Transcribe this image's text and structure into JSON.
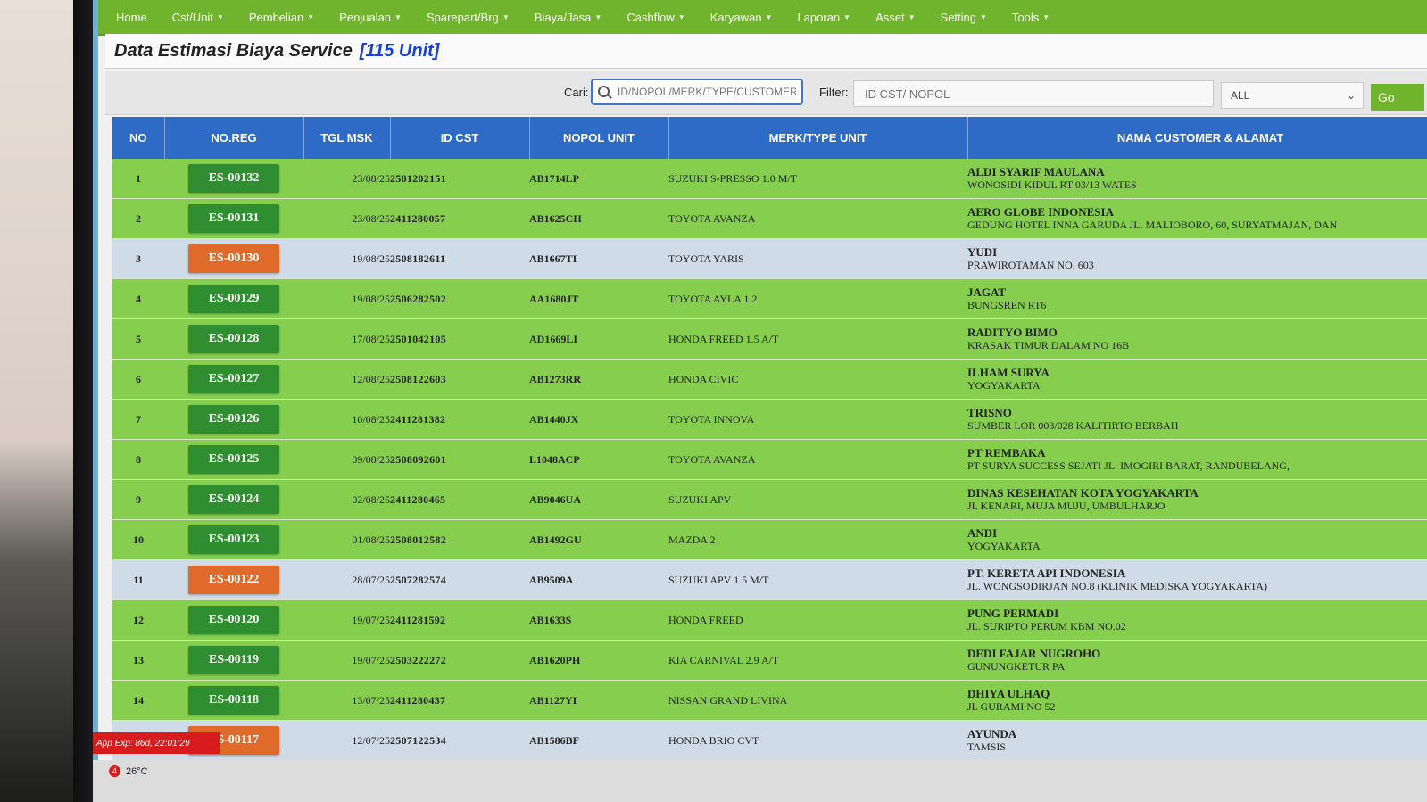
{
  "nav": {
    "items": [
      {
        "label": "Home",
        "caret": false
      },
      {
        "label": "Cst/Unit",
        "caret": true
      },
      {
        "label": "Pembelian",
        "caret": true
      },
      {
        "label": "Penjualan",
        "caret": true
      },
      {
        "label": "Sparepart/Brg",
        "caret": true
      },
      {
        "label": "Biaya/Jasa",
        "caret": true
      },
      {
        "label": "Cashflow",
        "caret": true
      },
      {
        "label": "Karyawan",
        "caret": true
      },
      {
        "label": "Laporan",
        "caret": true
      },
      {
        "label": "Asset",
        "caret": true
      },
      {
        "label": "Setting",
        "caret": true
      },
      {
        "label": "Tools",
        "caret": true
      }
    ]
  },
  "page": {
    "title": "Data Estimasi Biaya Service",
    "unit_count": "[115 Unit]"
  },
  "search": {
    "cari_label": "Cari:",
    "placeholder": "ID/NOPOL/MERK/TYPE/CUSTOMER",
    "filter_label": "Filter:",
    "filter_placeholder": "ID CST/ NOPOL",
    "select_value": "ALL",
    "go_label": "Go"
  },
  "table": {
    "headers": [
      "NO",
      "NO.REG",
      "TGL MSK",
      "ID CST",
      "NOPOL UNIT",
      "MERK/TYPE UNIT",
      "NAMA CUSTOMER & ALAMAT"
    ],
    "rows": [
      {
        "no": "1",
        "reg": "ES-00132",
        "status": "green",
        "tgl": "23/08/25",
        "idcst": "2501202151",
        "nopol": "AB1714LP",
        "merk": "SUZUKI S-PRESSO 1.0 M/T",
        "name": "ALDI SYARIF MAULANA",
        "addr": "WONOSIDI KIDUL RT 03/13 WATES"
      },
      {
        "no": "2",
        "reg": "ES-00131",
        "status": "green",
        "tgl": "23/08/25",
        "idcst": "2411280057",
        "nopol": "AB1625CH",
        "merk": "TOYOTA AVANZA",
        "name": "AERO GLOBE INDONESIA",
        "addr": "GEDUNG HOTEL INNA GARUDA JL. MALIOBORO, 60, SURYATMAJAN, DAN"
      },
      {
        "no": "3",
        "reg": "ES-00130",
        "status": "orange",
        "tgl": "19/08/25",
        "idcst": "2508182611",
        "nopol": "AB1667TI",
        "merk": "TOYOTA YARIS",
        "name": "YUDI",
        "addr": "PRAWIROTAMAN NO. 603"
      },
      {
        "no": "4",
        "reg": "ES-00129",
        "status": "green",
        "tgl": "19/08/25",
        "idcst": "2506282502",
        "nopol": "AA1680JT",
        "merk": "TOYOTA AYLA 1.2",
        "name": "JAGAT",
        "addr": "BUNGSREN RT6"
      },
      {
        "no": "5",
        "reg": "ES-00128",
        "status": "green",
        "tgl": "17/08/25",
        "idcst": "2501042105",
        "nopol": "AD1669LI",
        "merk": "HONDA FREED 1.5 A/T",
        "name": "RADITYO BIMO",
        "addr": "KRASAK TIMUR DALAM NO 16B"
      },
      {
        "no": "6",
        "reg": "ES-00127",
        "status": "green",
        "tgl": "12/08/25",
        "idcst": "2508122603",
        "nopol": "AB1273RR",
        "merk": "HONDA CIVIC",
        "name": "ILHAM SURYA",
        "addr": "YOGYAKARTA"
      },
      {
        "no": "7",
        "reg": "ES-00126",
        "status": "green",
        "tgl": "10/08/25",
        "idcst": "2411281382",
        "nopol": "AB1440JX",
        "merk": "TOYOTA INNOVA",
        "name": "TRISNO",
        "addr": "SUMBER LOR 003/028 KALITIRTO BERBAH"
      },
      {
        "no": "8",
        "reg": "ES-00125",
        "status": "green",
        "tgl": "09/08/25",
        "idcst": "2508092601",
        "nopol": "L1048ACP",
        "merk": "TOYOTA AVANZA",
        "name": "PT REMBAKA",
        "addr": "PT SURYA SUCCESS SEJATI JL. IMOGIRI BARAT, RANDUBELANG,"
      },
      {
        "no": "9",
        "reg": "ES-00124",
        "status": "green",
        "tgl": "02/08/25",
        "idcst": "2411280465",
        "nopol": "AB9046UA",
        "merk": "SUZUKI APV",
        "name": "DINAS KESEHATAN KOTA YOGYAKARTA",
        "addr": "JL KENARI, MUJA MUJU, UMBULHARJO"
      },
      {
        "no": "10",
        "reg": "ES-00123",
        "status": "green",
        "tgl": "01/08/25",
        "idcst": "2508012582",
        "nopol": "AB1492GU",
        "merk": "MAZDA 2",
        "name": "ANDI",
        "addr": "YOGYAKARTA"
      },
      {
        "no": "11",
        "reg": "ES-00122",
        "status": "orange",
        "tgl": "28/07/25",
        "idcst": "2507282574",
        "nopol": "AB9509A",
        "merk": "SUZUKI APV 1.5 M/T",
        "name": "PT. KERETA API INDONESIA",
        "addr": "JL. WONGSODIRJAN NO.8 (KLINIK MEDISKA YOGYAKARTA)"
      },
      {
        "no": "12",
        "reg": "ES-00120",
        "status": "green",
        "tgl": "19/07/25",
        "idcst": "2411281592",
        "nopol": "AB1633S",
        "merk": "HONDA FREED",
        "name": "PUNG PERMADI",
        "addr": "JL. SURIPTO PERUM KBM NO.02"
      },
      {
        "no": "13",
        "reg": "ES-00119",
        "status": "green",
        "tgl": "19/07/25",
        "idcst": "2503222272",
        "nopol": "AB1620PH",
        "merk": "KIA CARNIVAL 2.9 A/T",
        "name": "DEDI FAJAR NUGROHO",
        "addr": "GUNUNGKETUR PA"
      },
      {
        "no": "14",
        "reg": "ES-00118",
        "status": "green",
        "tgl": "13/07/25",
        "idcst": "2411280437",
        "nopol": "AB1127YI",
        "merk": "NISSAN GRAND LIVINA",
        "name": "DHIYA ULHAQ",
        "addr": "JL GURAMI NO 52"
      },
      {
        "no": "15",
        "reg": "ES-00117",
        "status": "orange",
        "tgl": "12/07/25",
        "idcst": "2507122534",
        "nopol": "AB1586BF",
        "merk": "HONDA BRIO CVT",
        "name": "AYUNDA",
        "addr": "TAMSIS"
      }
    ]
  },
  "footer": {
    "app_expiry": "App Exp: 86d, 22:01:29",
    "weather_badge": "4",
    "temperature": "26°C"
  },
  "colors": {
    "nav_bg": "#6fb42c",
    "header_bg": "#2d6bc6",
    "row_green": "#86cf4e",
    "row_alt": "#cfdbe6",
    "reg_green": "#2f8e2f",
    "reg_orange": "#e06a2a",
    "title_accent": "#1a3fd0"
  }
}
